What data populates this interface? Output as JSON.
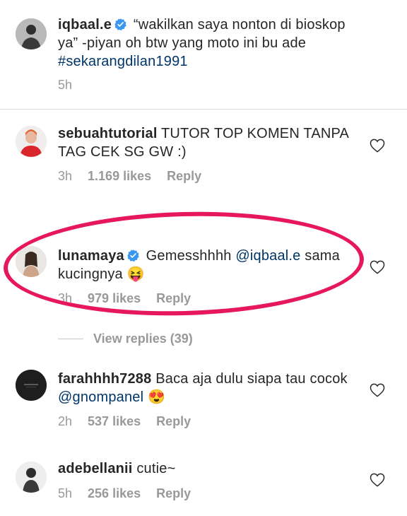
{
  "colors": {
    "text": "#262626",
    "muted": "#999999",
    "link": "#003569",
    "verified": "#3897f0",
    "highlight": "#e6175b",
    "divider": "#dbdbdb"
  },
  "caption": {
    "username": "iqbaal.e",
    "verified": true,
    "text": " “wakilkan saya nonton di bioskop ya” -piyan oh btw yang moto ini bu ade ",
    "hashtag": "#sekarangdilan1991",
    "time": "5h"
  },
  "comments": [
    {
      "username": "sebuahtutorial",
      "verified": false,
      "text": " TUTOR TOP KOMEN TANPA TAG CEK SG GW :)",
      "time": "3h",
      "likes": "1.169 likes",
      "reply": "Reply"
    },
    {
      "username": "lunamaya",
      "verified": true,
      "text_before": " Gemesshhhh ",
      "mention": "@iqbaal.e",
      "text_after": " sama kucingnya 😝",
      "time": "3h",
      "likes": "979 likes",
      "reply": "Reply",
      "view_replies": "View replies (39)"
    },
    {
      "username": "farahhhh7288",
      "verified": false,
      "text_before": " Baca aja dulu siapa tau cocok ",
      "mention": "@gnompanel",
      "text_after": " 😍",
      "time": "2h",
      "likes": "537 likes",
      "reply": "Reply"
    },
    {
      "username": "adebellanii",
      "verified": false,
      "text": " cutie~",
      "time": "5h",
      "likes": "256 likes",
      "reply": "Reply"
    }
  ],
  "icons": {
    "like": "heart-outline-icon",
    "verified": "verified-badge-icon"
  }
}
